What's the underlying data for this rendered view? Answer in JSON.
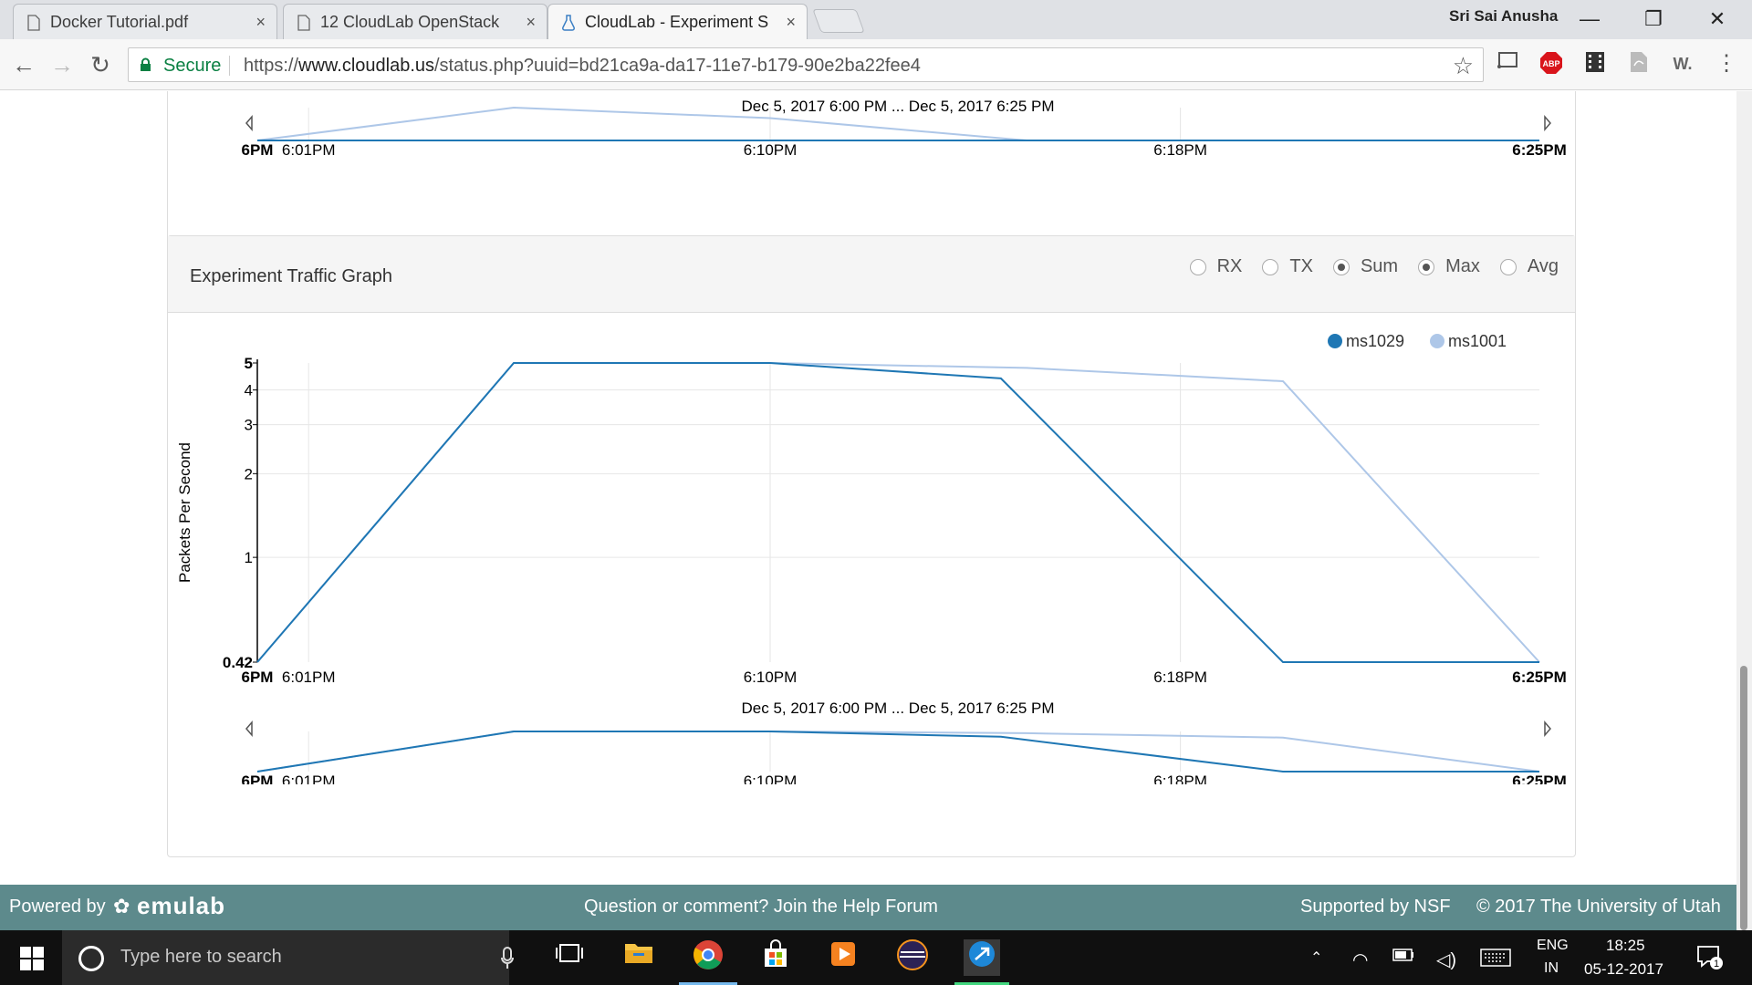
{
  "browser": {
    "tabs": [
      {
        "title": "Docker Tutorial.pdf",
        "close": "×"
      },
      {
        "title": "12 CloudLab OpenStack",
        "close": "×"
      },
      {
        "title": "CloudLab - Experiment S",
        "close": "×"
      }
    ],
    "profile_name": "Sri Sai Anusha",
    "window_controls": {
      "minimize": "—",
      "restore": "❐",
      "close": "✕"
    },
    "secure_label": "Secure",
    "url_scheme": "https://",
    "url_domain": "www.cloudlab.us",
    "url_path": "/status.php?uuid=bd21ca9a-da17-11e7-b179-90e2ba22fee4",
    "extensions": [
      "cast-icon",
      "adblock-icon",
      "film-icon",
      "pdf-icon",
      "w-icon",
      "menu-icon"
    ],
    "ext_labels": {
      "abp": "ABP",
      "w": "W."
    }
  },
  "top_chart": {
    "range_label": "Dec 5, 2017 6:00 PM ... Dec 5, 2017 6:25 PM",
    "ticks": [
      {
        "label": "6PM",
        "t": 0,
        "bold": true
      },
      {
        "label": "6:01PM",
        "t": 1,
        "bold": false
      },
      {
        "label": "6:10PM",
        "t": 10,
        "bold": false
      },
      {
        "label": "6:18PM",
        "t": 18,
        "bold": false
      },
      {
        "label": "6:25PM",
        "t": 25,
        "bold": true
      }
    ]
  },
  "traffic_panel": {
    "title": "Experiment Traffic Graph",
    "options": [
      {
        "label": "RX",
        "checked": false
      },
      {
        "label": "TX",
        "checked": false
      },
      {
        "label": "Sum",
        "checked": true
      },
      {
        "label": "Max",
        "checked": true
      },
      {
        "label": "Avg",
        "checked": false
      }
    ]
  },
  "chart_data": {
    "type": "line",
    "ylabel": "Packets Per Second",
    "y_ticks": [
      {
        "label": "0.42",
        "v": 0.42,
        "bold": true
      },
      {
        "label": "1",
        "v": 1,
        "bold": false
      },
      {
        "label": "2",
        "v": 2,
        "bold": false
      },
      {
        "label": "3",
        "v": 3,
        "bold": false
      },
      {
        "label": "4",
        "v": 4,
        "bold": false
      },
      {
        "label": "5",
        "v": 5,
        "bold": true
      }
    ],
    "ylim": [
      0.42,
      5
    ],
    "y_scale": "log",
    "x_ticks": [
      {
        "label": "6PM",
        "t": 0,
        "bold": true
      },
      {
        "label": "6:01PM",
        "t": 1,
        "bold": false
      },
      {
        "label": "6:10PM",
        "t": 10,
        "bold": false
      },
      {
        "label": "6:18PM",
        "t": 18,
        "bold": false
      },
      {
        "label": "6:25PM",
        "t": 25,
        "bold": true
      }
    ],
    "xlim": [
      0,
      25
    ],
    "range_label": "Dec 5, 2017 6:00 PM ... Dec 5, 2017 6:25 PM",
    "legend_position": "top-right",
    "series": [
      {
        "name": "ms1029",
        "color": "#1f77b4",
        "x": [
          0,
          5,
          10,
          14.5,
          20,
          25
        ],
        "y": [
          0.42,
          5,
          5,
          4.4,
          0.42,
          0.42
        ]
      },
      {
        "name": "ms1001",
        "color": "#aec7e8",
        "x": [
          0,
          5,
          10,
          15,
          20,
          25
        ],
        "y": [
          0.42,
          5,
          5,
          4.8,
          4.3,
          0.42
        ]
      }
    ]
  },
  "footer": {
    "powered_by": "Powered by",
    "brand": "emulab",
    "help": "Question or comment? Join the Help Forum",
    "nsf": "Supported by NSF",
    "copyright": "© 2017 The University of Utah"
  },
  "taskbar": {
    "search_placeholder": "Type here to search",
    "lang_top": "ENG",
    "lang_bottom": "IN",
    "time": "18:25",
    "date": "05-12-2017",
    "notification_count": "1"
  }
}
